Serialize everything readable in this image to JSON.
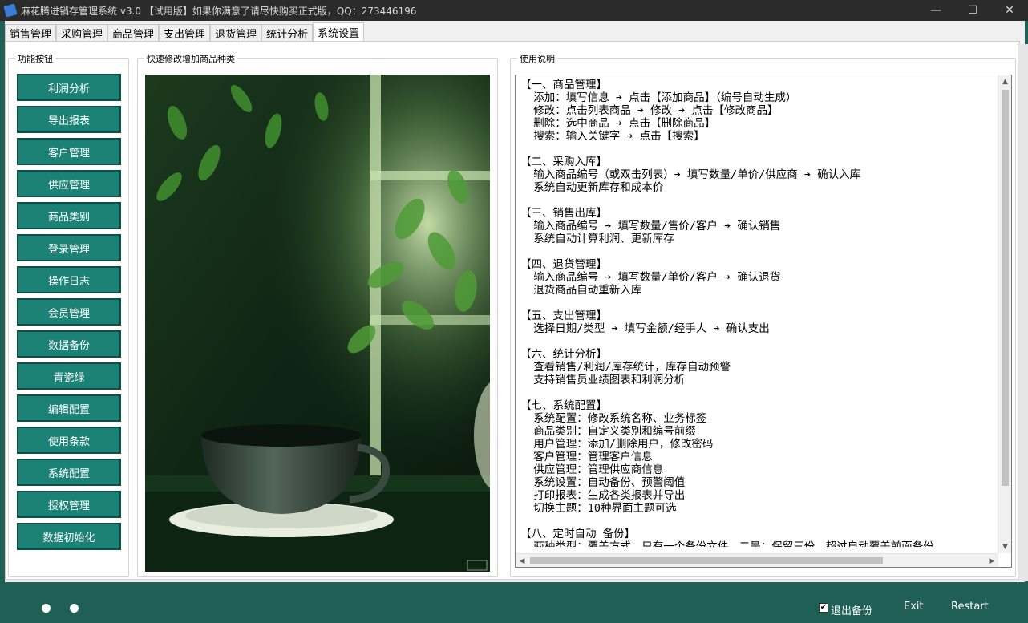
{
  "window": {
    "title": "麻花腾进销存管理系统 v3.0 【试用版】如果你满意了请尽快购买正式版，QQ：273446196",
    "controls": {
      "minimize": "—",
      "maximize": "☐",
      "close": "✕"
    }
  },
  "tabs": [
    {
      "label": "销售管理"
    },
    {
      "label": "采购管理"
    },
    {
      "label": "商品管理"
    },
    {
      "label": "支出管理"
    },
    {
      "label": "退货管理"
    },
    {
      "label": "统计分析"
    },
    {
      "label": "系统设置",
      "active": true
    }
  ],
  "function_group": {
    "label": "功能按钮",
    "buttons": [
      "利润分析",
      "导出报表",
      "客户管理",
      "供应管理",
      "商品类别",
      "登录管理",
      "操作日志",
      "会员管理",
      "数据备份",
      "青瓷绿",
      "编辑配置",
      "使用条款",
      "系统配置",
      "授权管理",
      "数据初始化"
    ]
  },
  "image_group": {
    "label": "快速修改增加商品种类"
  },
  "help_group": {
    "label": "使用说明",
    "lines": [
      "【一、商品管理】",
      "  添加：填写信息 ➔ 点击【添加商品】（编号自动生成）",
      "  修改：点击列表商品 ➔ 修改 ➔ 点击【修改商品】",
      "  删除：选中商品 ➔ 点击【删除商品】",
      "  搜索：输入关键字 ➔ 点击【搜索】",
      "",
      "【二、采购入库】",
      "  输入商品编号（或双击列表）➔ 填写数量/单价/供应商 ➔ 确认入库",
      "  系统自动更新库存和成本价",
      "",
      "【三、销售出库】",
      "  输入商品编号 ➔ 填写数量/售价/客户 ➔ 确认销售",
      "  系统自动计算利润、更新库存",
      "",
      "【四、退货管理】",
      "  输入商品编号 ➔ 填写数量/单价/客户 ➔ 确认退货",
      "  退货商品自动重新入库",
      "",
      "【五、支出管理】",
      "  选择日期/类型 ➔ 填写金额/经手人 ➔ 确认支出",
      "",
      "【六、统计分析】",
      "  查看销售/利润/库存统计，库存自动预警",
      "  支持销售员业绩图表和利润分析",
      "",
      "【七、系统配置】",
      "  系统配置：修改系统名称、业务标签",
      "  商品类别：自定义类别和编号前缀",
      "  用户管理：添加/删除用户，修改密码",
      "  客户管理：管理客户信息",
      "  供应管理：管理供应商信息",
      "  系统设置：自动备份、预警阈值",
      "  打印报表：生成各类报表并导出",
      "  切换主题：10种界面主题可选",
      "",
      "【八、定时自动 备份】",
      "  两种类型：覆盖方式，只有一个备份文件，二是：保留三份，超过自动覆盖前面备份"
    ]
  },
  "footer": {
    "checkbox_label": "退出备份",
    "checkbox_checked": true,
    "checkbox_mark": "✔",
    "exit_label": "Exit",
    "restart_label": "Restart"
  }
}
